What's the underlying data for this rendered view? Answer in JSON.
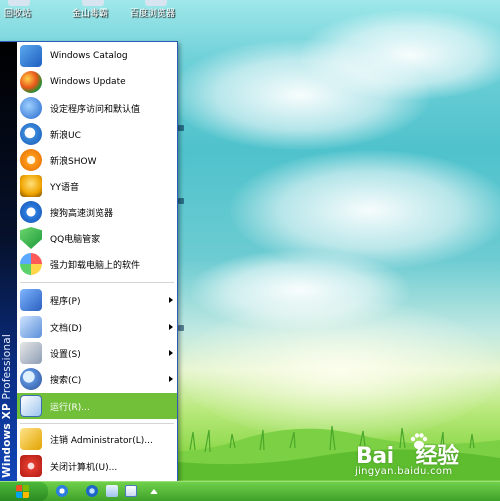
{
  "desktop": {
    "icons": [
      {
        "label": "回收站",
        "icon": "recycle-bin-icon"
      },
      {
        "label": "金山毒霸",
        "icon": "antivirus-icon"
      },
      {
        "label": "百度浏览器",
        "icon": "baidu-browser-icon"
      }
    ]
  },
  "start_menu": {
    "side_banner": {
      "os": "Windows XP",
      "edition": "Professional"
    },
    "pinned": [
      {
        "label": "Windows Catalog",
        "icon": "windows-catalog-icon"
      },
      {
        "label": "Windows Update",
        "icon": "windows-update-icon"
      },
      {
        "label": "设定程序访问和默认值",
        "icon": "program-defaults-icon"
      },
      {
        "label": "新浪UC",
        "icon": "sina-uc-icon"
      },
      {
        "label": "新浪SHOW",
        "icon": "sina-show-icon"
      },
      {
        "label": "YY语音",
        "icon": "yy-voice-icon"
      },
      {
        "label": "搜狗高速浏览器",
        "icon": "sogou-browser-icon"
      },
      {
        "label": "QQ电脑管家",
        "icon": "qq-pc-manager-icon"
      },
      {
        "label": "强力卸载电脑上的软件",
        "icon": "uninstaller-icon"
      }
    ],
    "system": [
      {
        "label": "程序(P)",
        "icon": "programs-icon",
        "submenu": true
      },
      {
        "label": "文档(D)",
        "icon": "documents-icon",
        "submenu": true
      },
      {
        "label": "设置(S)",
        "icon": "settings-icon",
        "submenu": true
      },
      {
        "label": "搜索(C)",
        "icon": "search-icon",
        "submenu": true
      },
      {
        "label": "运行(R)...",
        "icon": "run-icon",
        "submenu": false,
        "highlighted": true
      }
    ],
    "session": [
      {
        "label": "注销 Administrator(L)...",
        "icon": "log-off-icon"
      },
      {
        "label": "关闭计算机(U)...",
        "icon": "shut-down-icon"
      }
    ]
  },
  "taskbar": {
    "quick_launch": [
      "taskbar-app-icon",
      "ie-icon",
      "show-desktop-icon",
      "taskbar-window-icon"
    ]
  },
  "watermark": {
    "brand": "Bai",
    "brand_tail": "经验",
    "url": "jingyan.baidu.com"
  },
  "colors": {
    "highlight": "#72c03a",
    "banner": "#0b2f86",
    "taskbar": "#3fa12a"
  }
}
